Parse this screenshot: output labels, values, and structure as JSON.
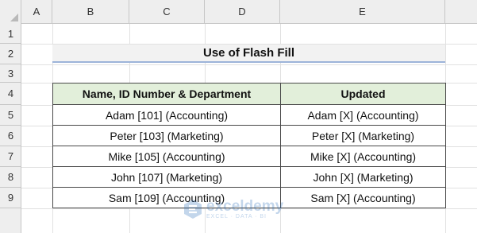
{
  "columns": [
    "A",
    "B",
    "C",
    "D",
    "E"
  ],
  "rows": [
    "1",
    "2",
    "3",
    "4",
    "5",
    "6",
    "7",
    "8",
    "9"
  ],
  "title": "Use of Flash Fill",
  "table": {
    "headers": [
      "Name, ID Number & Department",
      "Updated"
    ],
    "rows": [
      [
        "Adam [101] (Accounting)",
        "Adam [X] (Accounting)"
      ],
      [
        "Peter [103] (Marketing)",
        "Peter [X] (Marketing)"
      ],
      [
        "Mike [105] (Accounting)",
        "Mike [X] (Accounting)"
      ],
      [
        "John [107] (Marketing)",
        "John [X] (Marketing)"
      ],
      [
        "Sam [109] (Accounting)",
        "Sam [X] (Accounting)"
      ]
    ]
  },
  "watermark": {
    "name": "exceldemy",
    "tagline": "EXCEL · DATA · BI",
    "icon": "exceldemy-logo-icon"
  },
  "colors": {
    "header_fill": "#e2efda",
    "title_fill": "#f2f2f2",
    "title_underline": "#9db4d9",
    "gridline": "#e1e1e1"
  }
}
